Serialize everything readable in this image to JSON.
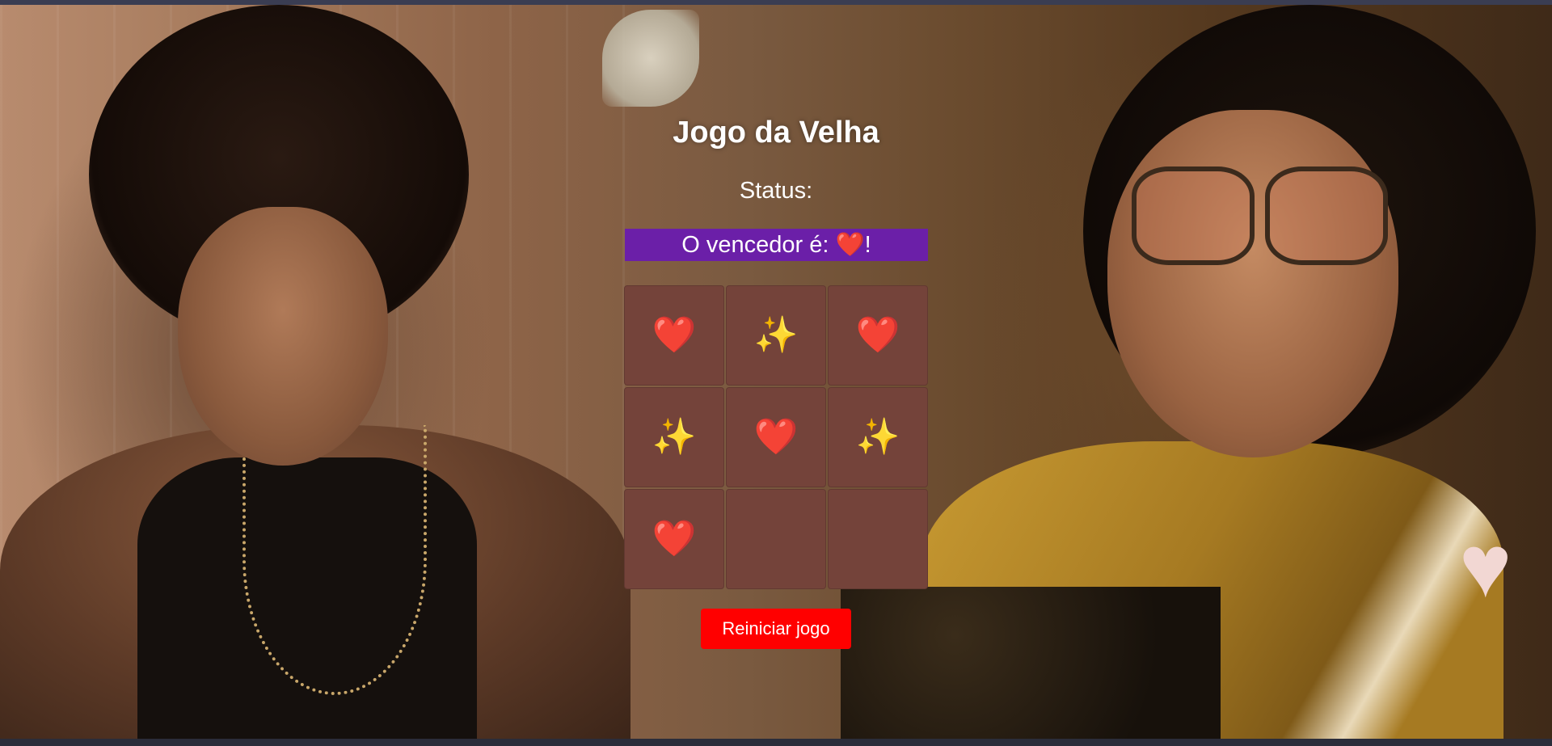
{
  "game": {
    "title": "Jogo da Velha",
    "status_label": "Status:",
    "winner_message": "O vencedor é: ❤️!",
    "restart_label": "Reiniciar jogo"
  },
  "board": {
    "cells": [
      "❤️",
      "✨",
      "❤️",
      "✨",
      "❤️",
      "✨",
      "❤️",
      "",
      ""
    ]
  },
  "colors": {
    "banner": "#6b1fa8",
    "cell": "#74433a",
    "restart_button": "#ff0000",
    "text": "#ffffff"
  },
  "background": {
    "icon_names": [
      "butterfly-decor",
      "heart-decor"
    ]
  }
}
